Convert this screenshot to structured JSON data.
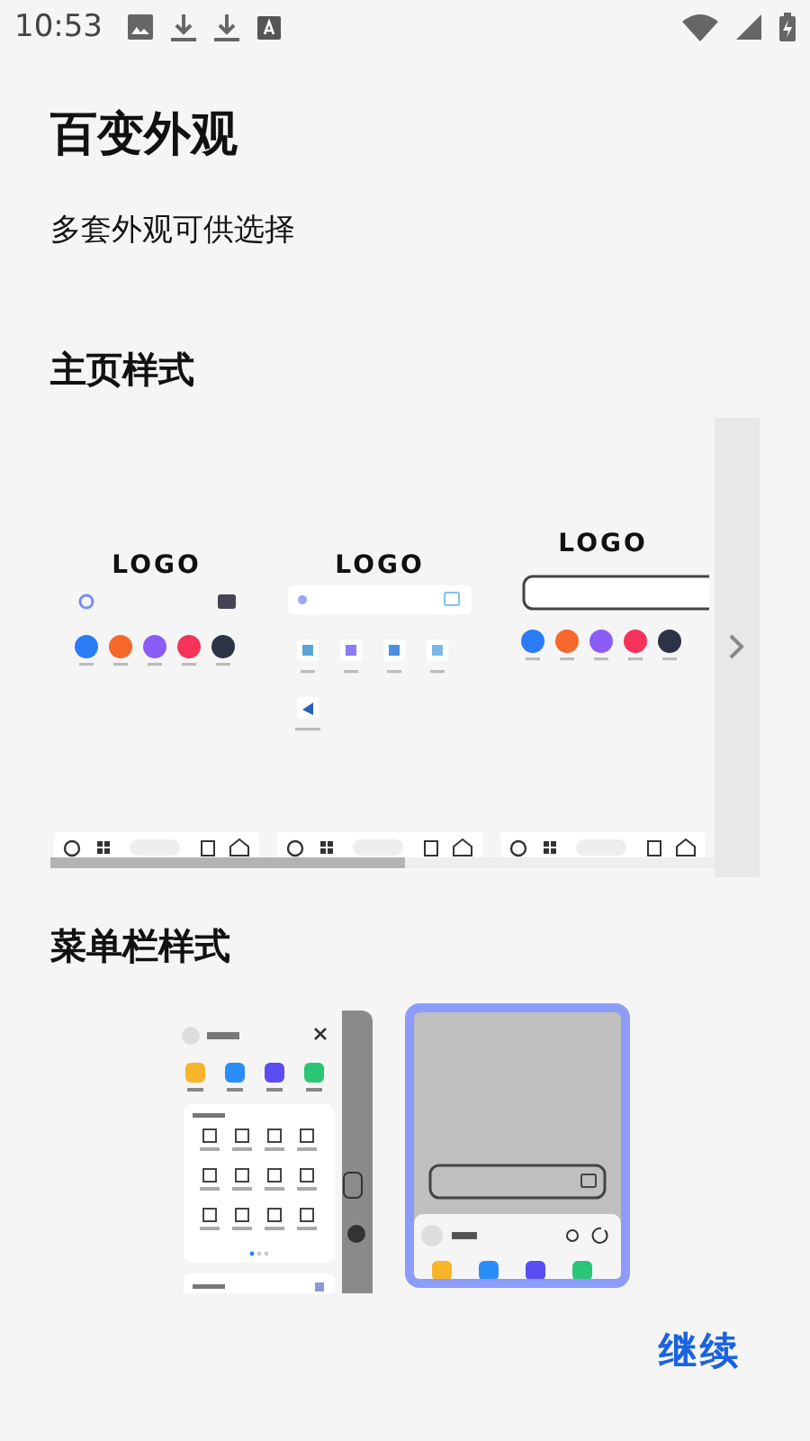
{
  "status_bar": {
    "time": "10:53"
  },
  "title": "百变外观",
  "subtitle": "多套外观可供选择",
  "home_section": {
    "heading": "主页样式",
    "styles": [
      {
        "kind": "round",
        "logo": "LOGO"
      },
      {
        "kind": "tiles",
        "logo": "LOGO"
      },
      {
        "kind": "outlined",
        "logo": "LOGO"
      }
    ]
  },
  "menu_section": {
    "heading": "菜单栏样式",
    "styles": [
      {
        "kind": "panel",
        "selected": false
      },
      {
        "kind": "sheet",
        "selected": true
      }
    ]
  },
  "continue_button": "继续"
}
